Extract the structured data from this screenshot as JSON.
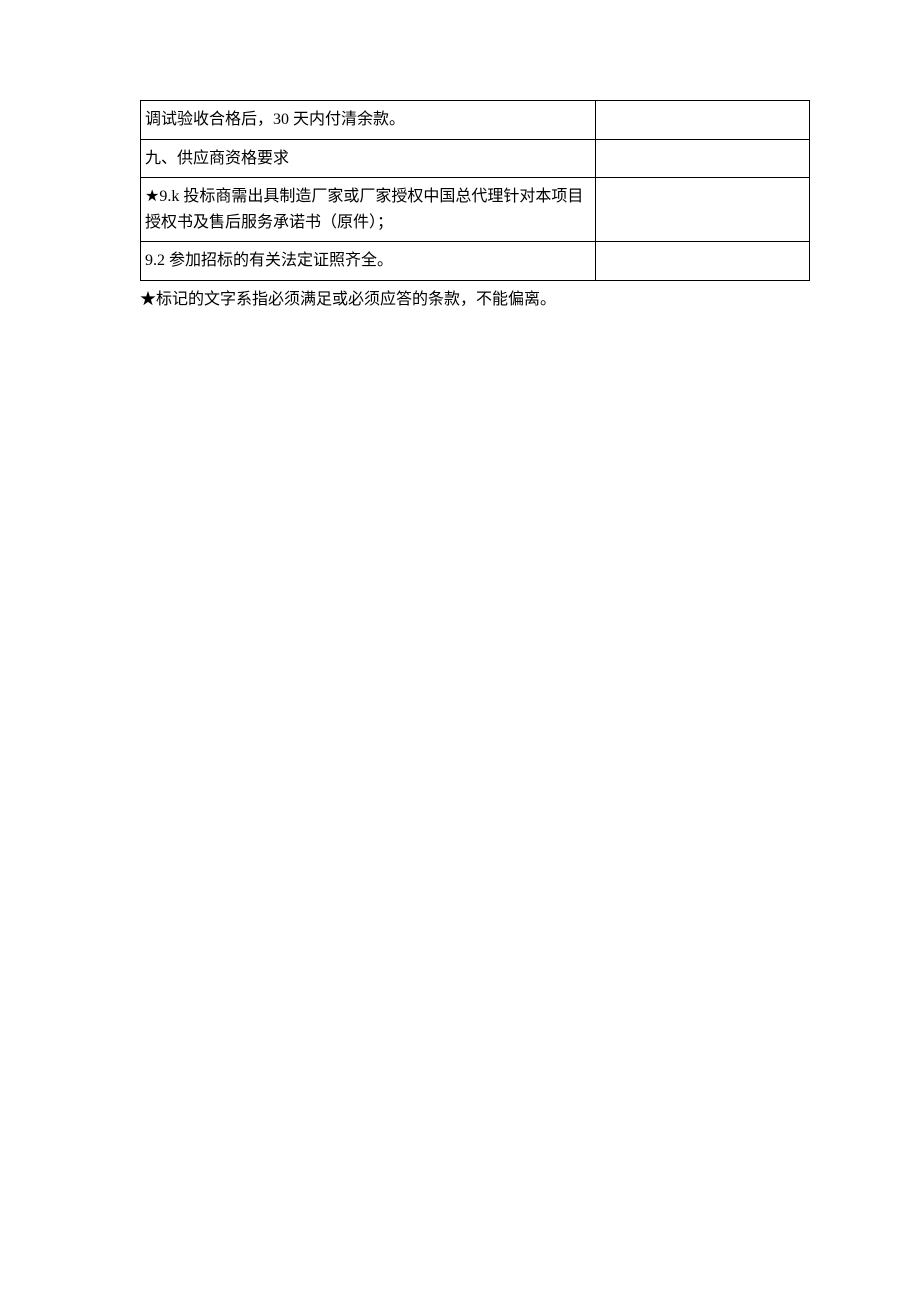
{
  "table": {
    "rows": [
      {
        "left": "调试验收合格后，30 天内付清余款。",
        "right": "",
        "indent": false
      },
      {
        "left": "九、供应商资格要求",
        "right": "",
        "indent": false
      },
      {
        "left": "★9.k 投标商需出具制造厂家或厂家授权中国总代理针对本项目授权书及售后服务承诺书（原件）；",
        "right": "",
        "indent": false
      },
      {
        "left": "9.2 参加招标的有关法定证照齐全。",
        "right": "",
        "indent": true
      }
    ]
  },
  "footnote": "★标记的文字系指必须满足或必须应答的条款，不能偏离。"
}
